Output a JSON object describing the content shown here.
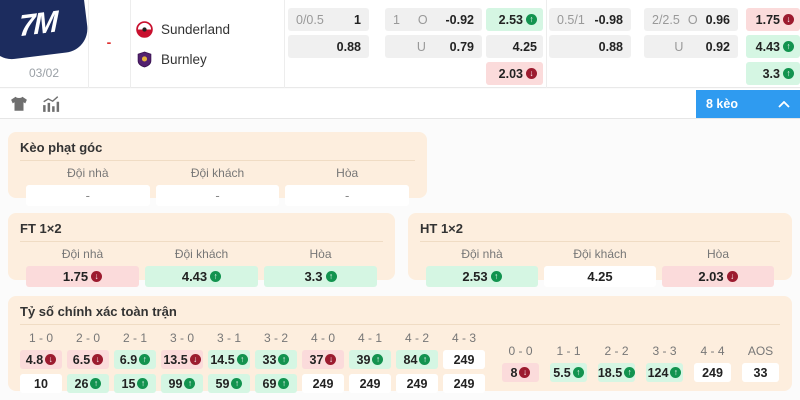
{
  "colors": {
    "accent_blue": "#2f9bf0",
    "logo_navy": "#1c2c5e",
    "panel_peach": "#fdeede",
    "odds_up_green_bg": "#d5f6e3",
    "odds_down_red_bg": "#fbdbdb",
    "neutral_gray_bg": "#f0f0f0",
    "trend_up": "#12934f",
    "trend_down": "#9c1b2f"
  },
  "header": {
    "logo_text": "7M",
    "date": "03/02",
    "score_placeholder": "-",
    "teams": [
      {
        "name": "Sunderland"
      },
      {
        "name": "Burnley"
      }
    ],
    "odds": {
      "group1": {
        "handicap": {
          "r1_label": "0/0.5",
          "r1_value": "1",
          "r2_value": "0.88"
        },
        "ou": {
          "r1_line": "1",
          "r1_side": "O",
          "r1_value": "-0.92",
          "r2_side": "U",
          "r2_value": "0.79"
        },
        "oneXtwo": [
          {
            "v": "2.53",
            "bg": "bg-green",
            "trend": "up"
          },
          {
            "v": "4.25",
            "bg": "bg-gray",
            "trend": "none"
          },
          {
            "v": "2.03",
            "bg": "bg-red",
            "trend": "down"
          }
        ]
      },
      "group2": {
        "handicap": {
          "r1_label": "0.5/1",
          "r1_value": "-0.98",
          "r2_value": "0.88"
        },
        "ou": {
          "r1_line": "2/2.5",
          "r1_side": "O",
          "r1_value": "0.96",
          "r2_side": "U",
          "r2_value": "0.92"
        },
        "oneXtwo": [
          {
            "v": "1.75",
            "bg": "bg-red",
            "trend": "down"
          },
          {
            "v": "4.43",
            "bg": "bg-green",
            "trend": "up"
          },
          {
            "v": "3.3",
            "bg": "bg-green",
            "trend": "up"
          }
        ]
      }
    }
  },
  "toolbar": {
    "icons": [
      "jersey-icon",
      "stats-icon"
    ],
    "odds_count_button": "8 kèo"
  },
  "corner_panel": {
    "title": "Kèo phạt góc",
    "headers": [
      "Đội nhà",
      "Đội khách",
      "Hòa"
    ],
    "cells": [
      {
        "v": "-"
      },
      {
        "v": "-"
      },
      {
        "v": "-"
      }
    ]
  },
  "ft_panel": {
    "title": "FT 1×2",
    "headers": [
      "Đội nhà",
      "Đội khách",
      "Hòa"
    ],
    "cells": [
      {
        "v": "1.75",
        "bg": "bg-red",
        "trend": "down"
      },
      {
        "v": "4.43",
        "bg": "bg-green",
        "trend": "up"
      },
      {
        "v": "3.3",
        "bg": "bg-green",
        "trend": "up"
      }
    ]
  },
  "ht_panel": {
    "title": "HT 1×2",
    "headers": [
      "Đội nhà",
      "Đội khách",
      "Hòa"
    ],
    "cells": [
      {
        "v": "2.53",
        "bg": "bg-green",
        "trend": "up"
      },
      {
        "v": "4.25",
        "bg": "bg-white",
        "trend": "none"
      },
      {
        "v": "2.03",
        "bg": "bg-red",
        "trend": "down"
      }
    ]
  },
  "score_panel": {
    "title": "Tỷ số chính xác toàn trận",
    "main_columns": [
      {
        "header": "1 - 0",
        "top": {
          "v": "4.8",
          "bg": "bg-red",
          "trend": "down"
        },
        "bottom": {
          "v": "10",
          "bg": "bg-white",
          "trend": "none"
        }
      },
      {
        "header": "2 - 0",
        "top": {
          "v": "6.5",
          "bg": "bg-red",
          "trend": "down"
        },
        "bottom": {
          "v": "26",
          "bg": "bg-green",
          "trend": "up"
        }
      },
      {
        "header": "2 - 1",
        "top": {
          "v": "6.9",
          "bg": "bg-green",
          "trend": "up"
        },
        "bottom": {
          "v": "15",
          "bg": "bg-green",
          "trend": "up"
        }
      },
      {
        "header": "3 - 0",
        "top": {
          "v": "13.5",
          "bg": "bg-red",
          "trend": "down"
        },
        "bottom": {
          "v": "99",
          "bg": "bg-green",
          "trend": "up"
        }
      },
      {
        "header": "3 - 1",
        "top": {
          "v": "14.5",
          "bg": "bg-green",
          "trend": "up"
        },
        "bottom": {
          "v": "59",
          "bg": "bg-green",
          "trend": "up"
        }
      },
      {
        "header": "3 - 2",
        "top": {
          "v": "33",
          "bg": "bg-green",
          "trend": "up"
        },
        "bottom": {
          "v": "69",
          "bg": "bg-green",
          "trend": "up"
        }
      },
      {
        "header": "4 - 0",
        "top": {
          "v": "37",
          "bg": "bg-red",
          "trend": "down"
        },
        "bottom": {
          "v": "249",
          "bg": "bg-white",
          "trend": "none"
        }
      },
      {
        "header": "4 - 1",
        "top": {
          "v": "39",
          "bg": "bg-green",
          "trend": "up"
        },
        "bottom": {
          "v": "249",
          "bg": "bg-white",
          "trend": "none"
        }
      },
      {
        "header": "4 - 2",
        "top": {
          "v": "84",
          "bg": "bg-green",
          "trend": "up"
        },
        "bottom": {
          "v": "249",
          "bg": "bg-white",
          "trend": "none"
        }
      },
      {
        "header": "4 - 3",
        "top": {
          "v": "249",
          "bg": "bg-white",
          "trend": "none"
        },
        "bottom": {
          "v": "249",
          "bg": "bg-white",
          "trend": "none"
        }
      }
    ],
    "draw_columns": [
      {
        "header": "0 - 0",
        "cell": {
          "v": "8",
          "bg": "bg-red",
          "trend": "down"
        }
      },
      {
        "header": "1 - 1",
        "cell": {
          "v": "5.5",
          "bg": "bg-green",
          "trend": "up"
        }
      },
      {
        "header": "2 - 2",
        "cell": {
          "v": "18.5",
          "bg": "bg-green",
          "trend": "up"
        }
      },
      {
        "header": "3 - 3",
        "cell": {
          "v": "124",
          "bg": "bg-green",
          "trend": "up"
        }
      },
      {
        "header": "4 - 4",
        "cell": {
          "v": "249",
          "bg": "bg-white",
          "trend": "none"
        }
      },
      {
        "header": "AOS",
        "cell": {
          "v": "33",
          "bg": "bg-white",
          "trend": "none"
        }
      }
    ]
  }
}
